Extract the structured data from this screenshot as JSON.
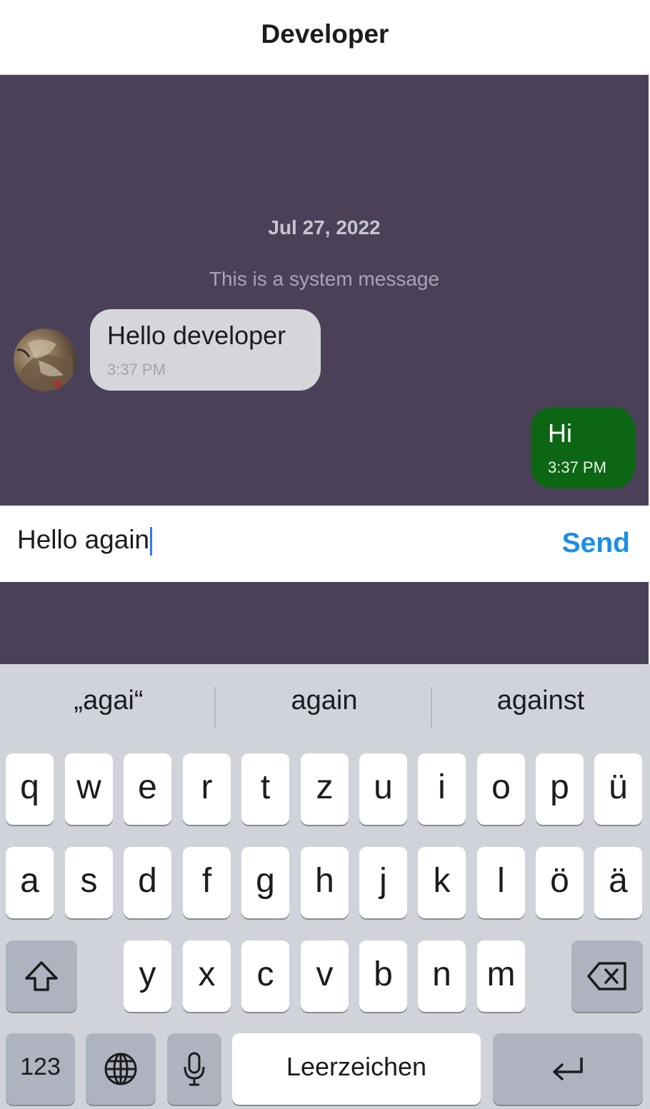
{
  "header": {
    "title": "Developer"
  },
  "chat": {
    "date_label": "Jul 27, 2022",
    "system_message": "This is a system message",
    "incoming": {
      "text": "Hello developer",
      "time": "3:37 PM"
    },
    "outgoing": {
      "text": "Hi",
      "time": "3:37 PM"
    }
  },
  "composer": {
    "value": "Hello again",
    "send_label": "Send"
  },
  "keyboard": {
    "suggestions": [
      "„agai“",
      "again",
      "against"
    ],
    "row1": [
      "q",
      "w",
      "e",
      "r",
      "t",
      "z",
      "u",
      "i",
      "o",
      "p",
      "ü"
    ],
    "row2": [
      "a",
      "s",
      "d",
      "f",
      "g",
      "h",
      "j",
      "k",
      "l",
      "ö",
      "ä"
    ],
    "row3": [
      "y",
      "x",
      "c",
      "v",
      "b",
      "n",
      "m"
    ],
    "numbers_label": "123",
    "space_label": "Leerzeichen",
    "icons": {
      "shift": "shift-arrow-icon",
      "backspace": "backspace-icon",
      "globe": "globe-icon",
      "mic": "microphone-icon",
      "return": "return-arrow-icon"
    }
  }
}
